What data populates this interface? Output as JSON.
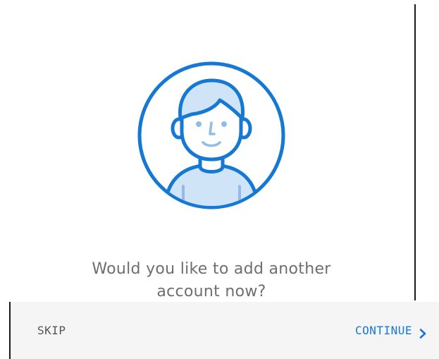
{
  "prompt": {
    "line1": "Would you like to add another",
    "line2": "account now?"
  },
  "footer": {
    "skip_label": "SKIP",
    "continue_label": "CONTINUE"
  },
  "icons": {
    "avatar": "user-avatar-icon",
    "continue_chevron": "chevron-right-icon"
  },
  "colors": {
    "accent": "#1478d4",
    "accent_light": "#cfe4f7",
    "text_muted": "#6e6e6e",
    "footer_bg": "#f5f5f5"
  }
}
